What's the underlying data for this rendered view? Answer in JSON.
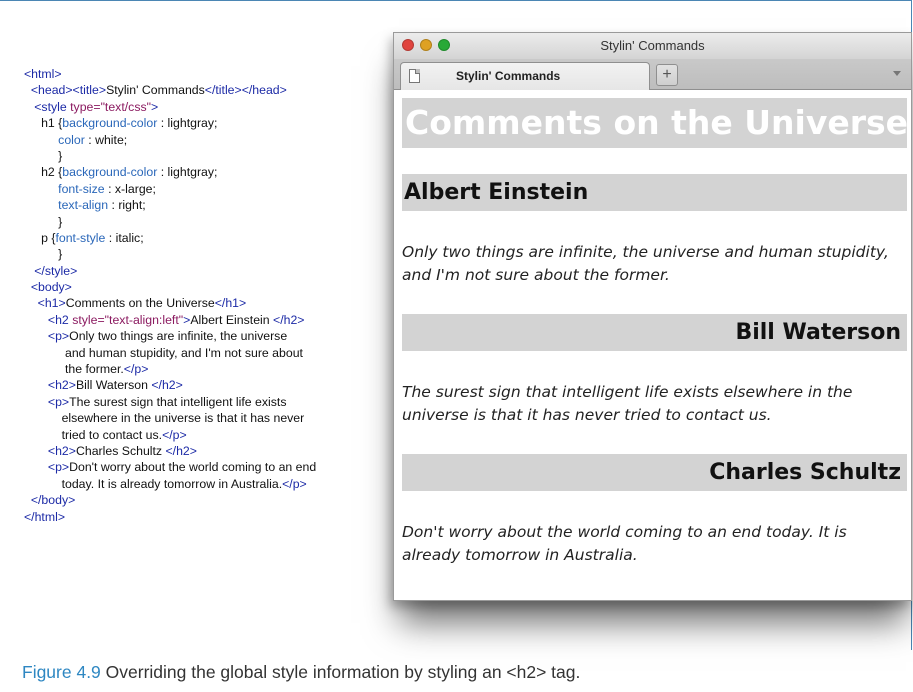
{
  "code_listing": {
    "lines": [
      [
        {
          "t": "<html>",
          "c": "tag"
        }
      ],
      [
        {
          "t": "  <head><title>",
          "c": "tag"
        },
        {
          "t": "Stylin' Commands"
        },
        {
          "t": "</title></head>",
          "c": "tag"
        }
      ],
      [
        {
          "t": "   <style ",
          "c": "tag"
        },
        {
          "t": "type=\"text/css\"",
          "c": "attr"
        },
        {
          "t": ">",
          "c": "tag"
        }
      ],
      [
        {
          "t": "     h1 {"
        },
        {
          "t": "background-color",
          "c": "prop"
        },
        {
          "t": " : lightgray;"
        }
      ],
      [
        {
          "t": "          "
        },
        {
          "t": "color",
          "c": "prop"
        },
        {
          "t": " : white;"
        }
      ],
      [
        {
          "t": "          }"
        }
      ],
      [
        {
          "t": "     h2 {"
        },
        {
          "t": "background-color",
          "c": "prop"
        },
        {
          "t": " : lightgray;"
        }
      ],
      [
        {
          "t": "          "
        },
        {
          "t": "font-size",
          "c": "prop"
        },
        {
          "t": " : x-large;"
        }
      ],
      [
        {
          "t": "          "
        },
        {
          "t": "text-align",
          "c": "prop"
        },
        {
          "t": " : right;"
        }
      ],
      [
        {
          "t": "          }"
        }
      ],
      [
        {
          "t": "     p {"
        },
        {
          "t": "font-style",
          "c": "prop"
        },
        {
          "t": " : italic;"
        }
      ],
      [
        {
          "t": "          }"
        }
      ],
      [
        {
          "t": "   </style>",
          "c": "tag"
        }
      ],
      [
        {
          "t": "  <body>",
          "c": "tag"
        }
      ],
      [
        {
          "t": "    <h1>",
          "c": "tag"
        },
        {
          "t": "Comments on the Universe"
        },
        {
          "t": "</h1>",
          "c": "tag"
        }
      ],
      [
        {
          "t": "       <h2 ",
          "c": "tag"
        },
        {
          "t": "style=\"text-align:left\"",
          "c": "attr"
        },
        {
          "t": ">",
          "c": "tag"
        },
        {
          "t": "Albert Einstein "
        },
        {
          "t": "</h2>",
          "c": "tag"
        }
      ],
      [
        {
          "t": "       <p>",
          "c": "tag"
        },
        {
          "t": "Only two things are infinite, the universe"
        }
      ],
      [
        {
          "t": "            and human stupidity, and I'm not sure about"
        }
      ],
      [
        {
          "t": "            the former."
        },
        {
          "t": "</p>",
          "c": "tag"
        }
      ],
      [
        {
          "t": "       <h2>",
          "c": "tag"
        },
        {
          "t": "Bill Waterson "
        },
        {
          "t": "</h2>",
          "c": "tag"
        }
      ],
      [
        {
          "t": "       <p>",
          "c": "tag"
        },
        {
          "t": "The surest sign that intelligent life exists"
        }
      ],
      [
        {
          "t": "           elsewhere in the universe is that it has never"
        }
      ],
      [
        {
          "t": "           tried to contact us."
        },
        {
          "t": "</p>",
          "c": "tag"
        }
      ],
      [
        {
          "t": "       <h2>",
          "c": "tag"
        },
        {
          "t": "Charles Schultz "
        },
        {
          "t": "</h2>",
          "c": "tag"
        }
      ],
      [
        {
          "t": "       <p>",
          "c": "tag"
        },
        {
          "t": "Don't worry about the world coming to an end"
        }
      ],
      [
        {
          "t": "           today. It is already tomorrow in Australia."
        },
        {
          "t": "</p>",
          "c": "tag"
        }
      ],
      [
        {
          "t": "  </body>",
          "c": "tag"
        }
      ],
      [
        {
          "t": "</html>",
          "c": "tag"
        }
      ]
    ]
  },
  "browser": {
    "window_title": "Stylin' Commands",
    "tab_label": "Stylin' Commands",
    "new_tab_label": "+",
    "page": {
      "h1": "Comments on the Universe",
      "sections": [
        {
          "heading": "Albert Einstein",
          "quote": "Only two things are infinite, the universe and human stupidity, and I'm not sure about the former."
        },
        {
          "heading": "Bill Waterson",
          "quote": "The surest sign that intelligent life exists elsewhere in the universe is that it has never tried to contact us."
        },
        {
          "heading": "Charles Schultz",
          "quote": "Don't worry about the world coming to an end today. It is already tomorrow in Australia."
        }
      ]
    }
  },
  "caption": {
    "number": "Figure 4.9",
    "text": " Overriding the global style information by styling an <h2> tag."
  },
  "colors": {
    "frame_border": "#4b86b4",
    "caption_number": "#2e87c2",
    "tag": "#1c2aa6",
    "attribute": "#8b1a60",
    "property": "#2a67b9",
    "heading_background": "#d3d3d3",
    "h1_text": "#ffffff"
  }
}
